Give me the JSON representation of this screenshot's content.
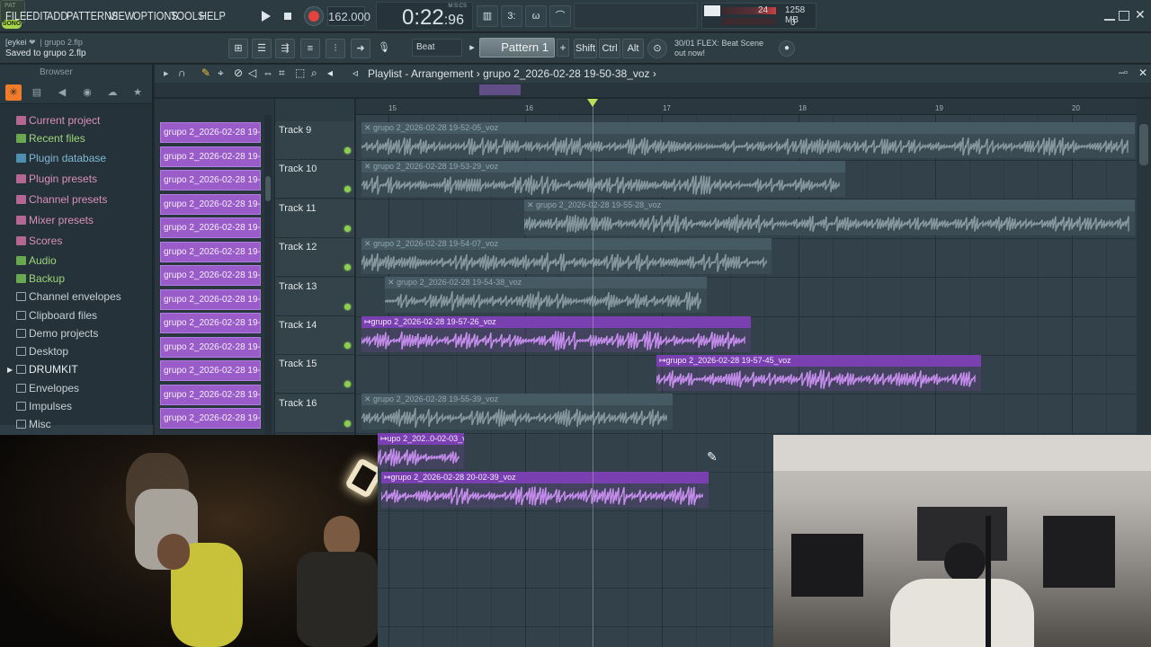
{
  "menu": [
    "FILE",
    "EDIT",
    "ADD",
    "PATTERNS",
    "VIEW",
    "OPTIONS",
    "TOOLS",
    "HELP"
  ],
  "transport": {
    "pat_label": "PAT",
    "song_label": "SONG",
    "tempo": "162.000",
    "time_main": "0:22",
    "time_sub": "96",
    "time_unit": "M:S:CS"
  },
  "cpu": {
    "value": "24",
    "memory": "1258 MB",
    "polyphony": "0"
  },
  "hint": {
    "user": "[eykei",
    "file": "grupo 2.flp"
  },
  "status": "Saved to grupo 2.flp",
  "snap": "Beat",
  "pattern": "Pattern 1",
  "modifiers": [
    "Shift",
    "Ctrl",
    "Alt"
  ],
  "news": {
    "line1": "30/01  FLEX: Beat Scene",
    "line2": "out now!"
  },
  "browser": {
    "title": "Browser",
    "items": [
      {
        "label": "Current project",
        "color": "pink"
      },
      {
        "label": "Recent files",
        "color": "green"
      },
      {
        "label": "Plugin database",
        "color": "blue"
      },
      {
        "label": "Plugin presets",
        "color": "pink"
      },
      {
        "label": "Channel presets",
        "color": "pink"
      },
      {
        "label": "Mixer presets",
        "color": "pink"
      },
      {
        "label": "Scores",
        "color": "pink"
      },
      {
        "label": "Audio",
        "color": "green"
      },
      {
        "label": "Backup",
        "color": "green"
      },
      {
        "label": "Channel envelopes",
        "color": "grey"
      },
      {
        "label": "Clipboard files",
        "color": "grey"
      },
      {
        "label": "Demo projects",
        "color": "grey"
      },
      {
        "label": "Desktop",
        "color": "grey"
      },
      {
        "label": "DRUMKIT",
        "color": "grey"
      },
      {
        "label": "Envelopes",
        "color": "grey"
      },
      {
        "label": "Impulses",
        "color": "grey"
      },
      {
        "label": "Misc",
        "color": "grey"
      }
    ]
  },
  "playlist": {
    "title": "Playlist - Arrangement",
    "crumb": "grupo 2_2026-02-28 19-50-38_voz",
    "picker_label": "grupo 2_2026-02-28 19-...",
    "ruler": [
      "15",
      "16",
      "17",
      "18",
      "19",
      "20"
    ],
    "tracks": [
      "Track 9",
      "Track 10",
      "Track 11",
      "Track 12",
      "Track 13",
      "Track 14",
      "Track 15",
      "Track 16"
    ],
    "clips": [
      {
        "track": 0,
        "name": "grupo 2_2026-02-28 19-52-05_voz",
        "muted": true
      },
      {
        "track": 1,
        "name": "grupo 2_2026-02-28 19-53-29_voz",
        "muted": true
      },
      {
        "track": 2,
        "name": "grupo 2_2026-02-28 19-55-28_voz",
        "muted": true
      },
      {
        "track": 3,
        "name": "grupo 2_2026-02-28 19-54-07_voz",
        "muted": true
      },
      {
        "track": 4,
        "name": "grupo 2_2026-02-28 19-54-38_voz",
        "muted": true
      },
      {
        "track": 5,
        "name": "grupo 2_2026-02-28 19-57-26_voz",
        "muted": false
      },
      {
        "track": 6,
        "name": "grupo 2_2026-02-28 19-57-45_voz",
        "muted": false
      },
      {
        "track": 7,
        "name": "grupo 2_2026-02-28 19-55-39_voz",
        "muted": true
      },
      {
        "track": 8,
        "name": "upo 2_202..0-02-03_voz",
        "muted": false
      },
      {
        "track": 9,
        "name": "grupo 2_2026-02-28 20-02-39_voz",
        "muted": false
      }
    ]
  },
  "colors": {
    "accent": "#9a5cc9",
    "clip_active": "#7a3fb0",
    "record": "#e2433d",
    "song_mode": "#a6d44a"
  }
}
